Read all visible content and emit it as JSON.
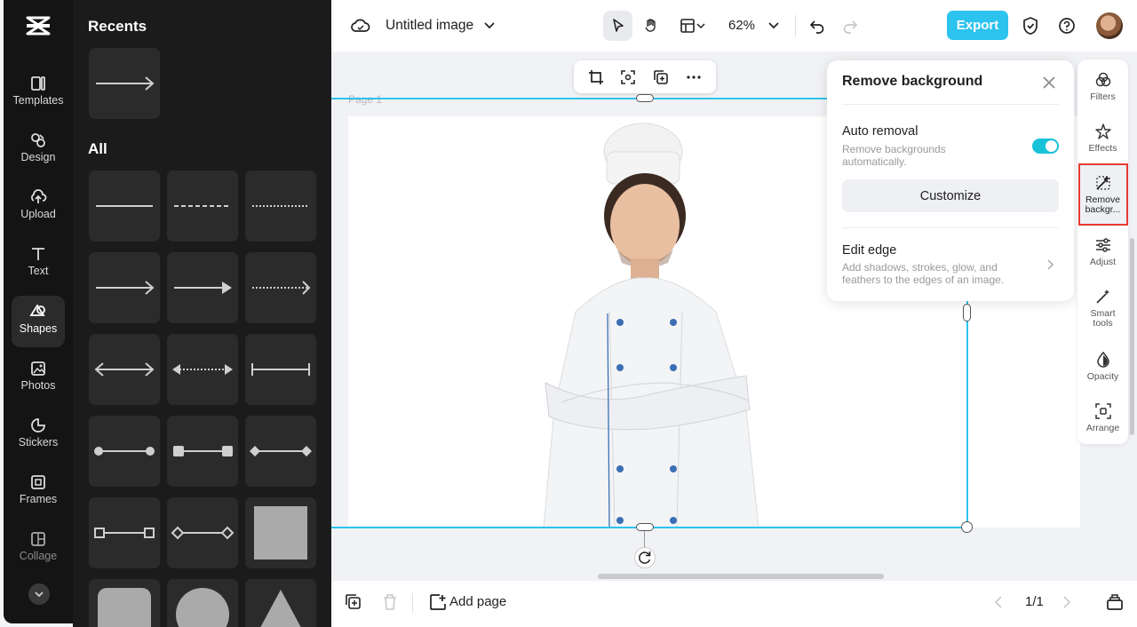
{
  "app": {
    "document_title": "Untitled image",
    "zoom": "62%",
    "export_label": "Export"
  },
  "rail": {
    "items": [
      {
        "label": "Templates",
        "icon": "templates-icon"
      },
      {
        "label": "Design",
        "icon": "design-icon"
      },
      {
        "label": "Upload",
        "icon": "upload-icon"
      },
      {
        "label": "Text",
        "icon": "text-icon"
      },
      {
        "label": "Shapes",
        "icon": "shapes-icon",
        "active": true
      },
      {
        "label": "Photos",
        "icon": "photos-icon"
      },
      {
        "label": "Stickers",
        "icon": "stickers-icon"
      },
      {
        "label": "Frames",
        "icon": "frames-icon"
      },
      {
        "label": "Collage",
        "icon": "collage-icon"
      }
    ]
  },
  "panel": {
    "recents_heading": "Recents",
    "all_heading": "All"
  },
  "canvas": {
    "page_label": "Page 1"
  },
  "remove_bg": {
    "title": "Remove background",
    "auto_title": "Auto removal",
    "auto_desc_line1": "Remove backgrounds",
    "auto_desc_line2": "automatically.",
    "auto_enabled": true,
    "customize_label": "Customize",
    "edge_title": "Edit edge",
    "edge_desc_line1": "Add shadows, strokes, glow, and",
    "edge_desc_line2": "feathers to the edges of an image."
  },
  "right_tools": {
    "filters": "Filters",
    "effects": "Effects",
    "remove_bg_line1": "Remove",
    "remove_bg_line2": "backgr...",
    "adjust": "Adjust",
    "smart_line1": "Smart",
    "smart_line2": "tools",
    "opacity": "Opacity",
    "arrange": "Arrange"
  },
  "bottom": {
    "add_page": "Add page",
    "pager": "1/1"
  },
  "colors": {
    "accent": "#2cc3ee",
    "toggle": "#18c2d8",
    "highlight": "#e53935"
  }
}
